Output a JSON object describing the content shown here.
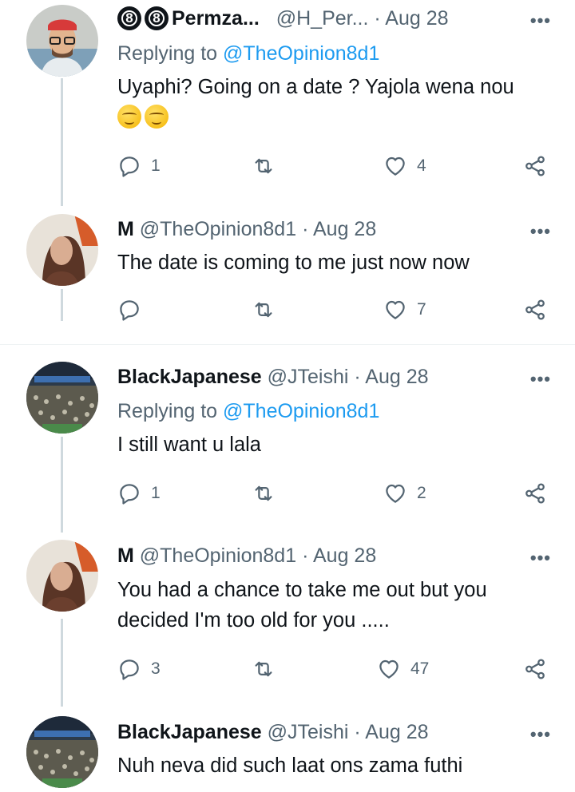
{
  "tweets": [
    {
      "badges": [
        "8",
        "8"
      ],
      "name": "Permza...",
      "handle": "@H_Per...",
      "dot": "·",
      "date": "Aug 28",
      "replying_prefix": "Replying to ",
      "replying_to": "@TheOpinion8d1",
      "text": "Uyaphi? Going on a date ? Yajola wena nou",
      "emoji": [
        "smirking-face-emoji",
        "smirking-face-emoji"
      ],
      "reply_count": "1",
      "retweet_count": "",
      "like_count": "4",
      "more": "•••"
    },
    {
      "name": "M",
      "handle": "@TheOpinion8d1",
      "dot": "·",
      "date": "Aug 28",
      "text": "The date is coming to me just now now",
      "reply_count": "",
      "retweet_count": "",
      "like_count": "7",
      "more": "•••"
    },
    {
      "name": "BlackJapanese",
      "handle": "@JTeishi",
      "dot": "·",
      "date": "Aug 28",
      "replying_prefix": "Replying to ",
      "replying_to": "@TheOpinion8d1",
      "text": "I still want u lala",
      "reply_count": "1",
      "retweet_count": "",
      "like_count": "2",
      "more": "•••"
    },
    {
      "name": "M",
      "handle": "@TheOpinion8d1",
      "dot": "·",
      "date": "Aug 28",
      "text_line1": "You had a chance to take me out but you",
      "text_line2": "decided I'm too old for you .....",
      "reply_count": "3",
      "retweet_count": "",
      "like_count": "47",
      "more": "•••"
    },
    {
      "name": "BlackJapanese",
      "handle": "@JTeishi",
      "dot": "·",
      "date": "Aug 28",
      "text": "Nuh neva did such laat ons zama futhi",
      "more": "•••"
    }
  ],
  "colors": {
    "text": "#0f1419",
    "secondary": "#536471",
    "link": "#1d9bf0",
    "thread_line": "#cfd9de"
  },
  "icons": [
    "reply-icon",
    "retweet-icon",
    "like-icon",
    "share-icon",
    "more-icon"
  ]
}
